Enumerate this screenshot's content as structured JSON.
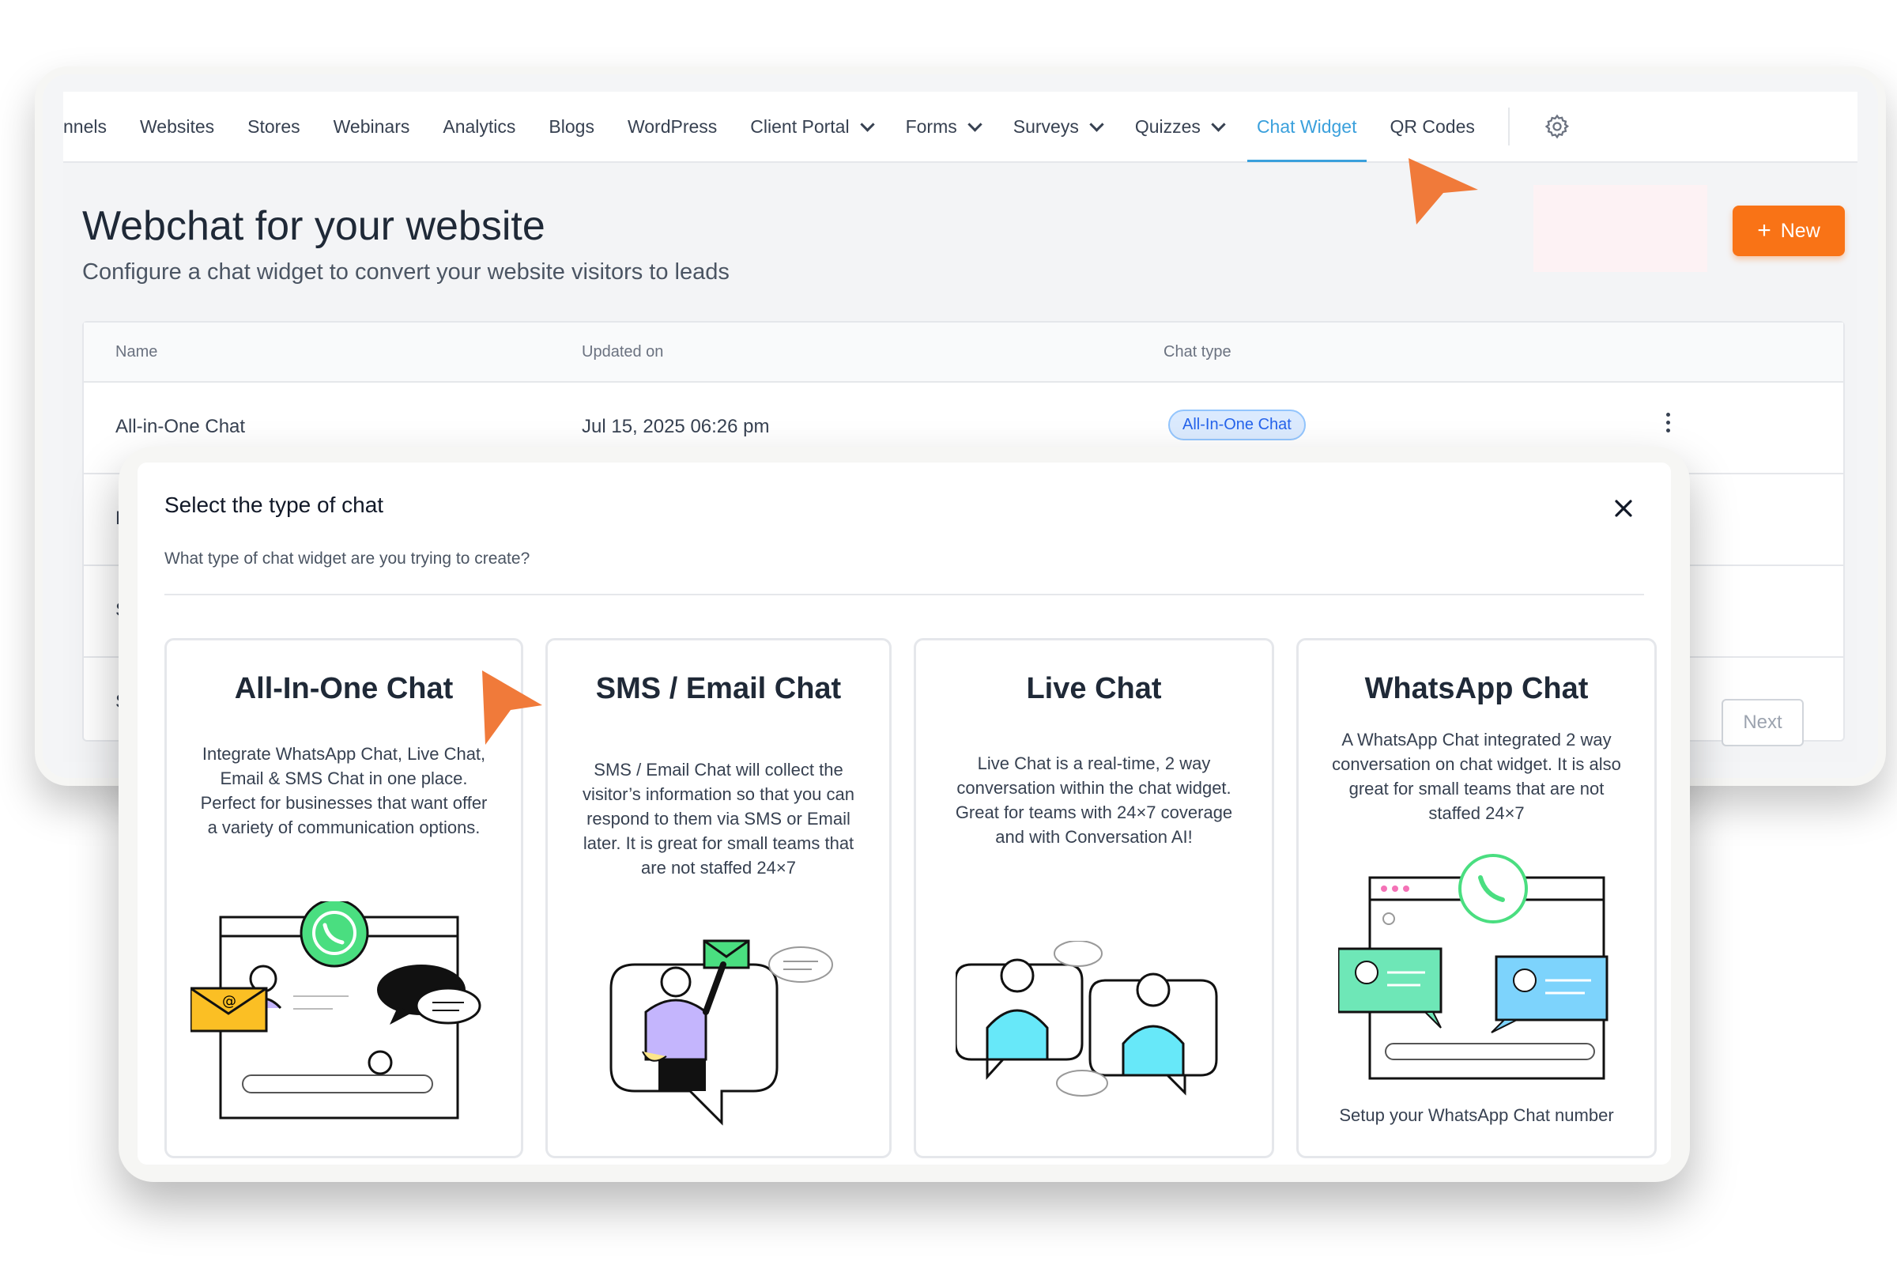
{
  "nav": {
    "items": [
      "nnels",
      "Websites",
      "Stores",
      "Webinars",
      "Analytics",
      "Blogs",
      "WordPress",
      "Client Portal",
      "Forms",
      "Surveys",
      "Quizzes",
      "Chat Widget",
      "QR Codes"
    ],
    "active": "Chat Widget",
    "dropdown_items": [
      "Client Portal",
      "Forms",
      "Surveys",
      "Quizzes"
    ]
  },
  "page": {
    "title": "Webchat for your website",
    "subtitle": "Configure a chat widget to convert your website visitors to leads",
    "new_label": "New"
  },
  "table": {
    "headers": [
      "Name",
      "Updated on",
      "Chat type"
    ],
    "rows": [
      {
        "name": "All-in-One Chat",
        "updated": "Jul 15, 2025 06:26 pm",
        "type": "All-In-One Chat"
      },
      {
        "name": "L",
        "updated": "",
        "type": ""
      },
      {
        "name": "S",
        "updated": "",
        "type": ""
      },
      {
        "name": "S",
        "updated": "",
        "type": ""
      }
    ],
    "next_label": "Next"
  },
  "modal": {
    "title": "Select the type of chat",
    "subtitle": "What type of chat widget are you trying to create?",
    "cards": [
      {
        "title": "All-In-One Chat",
        "description": "Integrate WhatsApp Chat, Live Chat, Email & SMS Chat in one place. Perfect for businesses that want offer a variety of communication options.",
        "footer": ""
      },
      {
        "title": "SMS / Email Chat",
        "description": "SMS / Email Chat will collect the visitor’s information so that you can respond to them via SMS or Email later. It is great for small teams that are not staffed 24×7",
        "footer": ""
      },
      {
        "title": "Live Chat",
        "description": "Live Chat is a real-time, 2 way conversation within the chat widget. Great for teams with 24×7 coverage and with Conversation AI!",
        "footer": ""
      },
      {
        "title": "WhatsApp Chat",
        "description": "A WhatsApp Chat integrated 2 way conversation on chat widget. It is also great for small teams that are not staffed 24×7",
        "footer": "Setup your WhatsApp Chat number"
      }
    ]
  },
  "colors": {
    "accent": "#3aa0dc",
    "orange": "#f97316",
    "cursor": "#f07a3a",
    "whatsapp_green": "#4ade80"
  }
}
